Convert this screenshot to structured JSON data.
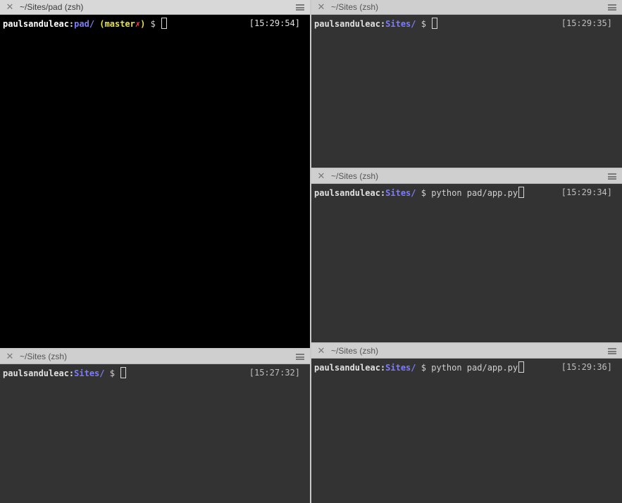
{
  "panes": {
    "left_top": {
      "title": "~/Sites/pad (zsh)",
      "user": "paulsanduleac",
      "colon": ":",
      "dir": "pad/",
      "branch_open": "(",
      "branch": "master",
      "dirty_mark": "✗",
      "branch_close": ")",
      "prompt": "$",
      "time": "[15:29:54]"
    },
    "left_bottom": {
      "title": "~/Sites (zsh)",
      "user": "paulsanduleac",
      "colon": ":",
      "dir": "Sites/",
      "prompt": "$",
      "time": "[15:27:32]"
    },
    "right_top": {
      "title": "~/Sites (zsh)",
      "user": "paulsanduleac",
      "colon": ":",
      "dir": "Sites/",
      "prompt": "$",
      "time": "[15:29:35]"
    },
    "right_middle": {
      "title": "~/Sites (zsh)",
      "user": "paulsanduleac",
      "colon": ":",
      "dir": "Sites/",
      "prompt": "$",
      "command": "python pad/app.py",
      "time": "[15:29:34]"
    },
    "right_bottom": {
      "title": "~/Sites (zsh)",
      "user": "paulsanduleac",
      "colon": ":",
      "dir": "Sites/",
      "prompt": "$",
      "command": "python pad/app.py",
      "time": "[15:29:36]"
    }
  },
  "icons": {
    "close": "close-icon",
    "menu": "hamburger-menu-icon"
  },
  "colors": {
    "active_background": "#000000",
    "inactive_background": "#333333",
    "directory": "#7c7cf5",
    "branch": "#e5e050",
    "dirty": "#ff4a4a",
    "titlebar": "#d0d0d0"
  }
}
